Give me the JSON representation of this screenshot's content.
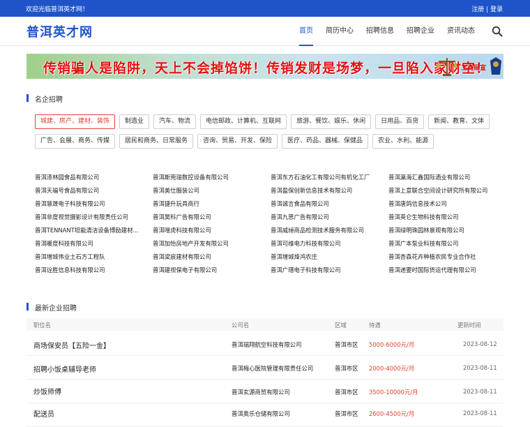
{
  "topbar": {
    "welcome": "欢迎光临普洱英才网！",
    "register": "注册",
    "sep": " | ",
    "login": "登录"
  },
  "header": {
    "logo": "普洱英才网"
  },
  "nav": [
    {
      "label": "首页",
      "active": true
    },
    {
      "label": "简历中心"
    },
    {
      "label": "招聘信息"
    },
    {
      "label": "招聘企业"
    },
    {
      "label": "资讯动态"
    }
  ],
  "banner": {
    "text": "传销骗人是陷阱，天上不会掉馅饼！传销发财是场梦，一旦陷入家财空！",
    "badge": "工商局宣"
  },
  "famous": {
    "title": "名企招聘",
    "tag_rows": [
      [
        "城建、房产、建材、装饰",
        "制造业",
        "汽车、物流",
        "电信邮政、计算机、互联网",
        "旅游、餐饮、娱乐、休闲",
        "日用品、百货",
        "新闻、教育、文体"
      ],
      [
        "广告、会展、商务、传媒",
        "居民和商务、日常服务",
        "咨询、贸易、开发、保险",
        "医疗、药品、器械、保健品",
        "农业、水利、能源"
      ]
    ],
    "companies": [
      "普洱泽林园食品有限公司",
      "普洱斯莞瑞数控设备有限公司",
      "普洱东方石油化工有限公司有机化工厂",
      "普洱瀛海汇鑫国际酒业有限公司",
      "普洱天福号食品有限公司",
      "普洱美仕服装公司",
      "普洱盈保创新信息技术有限公司",
      "普洱上意联合空间设计研究所有限公司",
      "普洱慧晟电子科技有限公司",
      "普洱捷升玩具商行",
      "普洱诚言食品有限公司",
      "普洱唐鸽信息技术公司",
      "普洱非度视觉摄影设计有限责任公司",
      "普洱昊科广告有限公司",
      "普洱九思广告有限公司",
      "普洱英仑生物科技有限公司",
      "普洱TENNANT坦能清洁设备博励建材…",
      "普洱嗖虎科技有限公司",
      "普洱威绰商品检测技术服务有限公司",
      "普洱绿明珠园林景观有限公司",
      "普洱暖度科技有限公司",
      "普洱加怡房地产开发有限公司",
      "普洱可维电力科技有限公司",
      "普洱广本泵业科技有限公司",
      "普洱增城伟业土石方工程队",
      "普洱梁宸建材有限公司",
      "普洱增城烽鸿农庄",
      "普洱杏森花卉种植农民专业合作社",
      "普洱诠胜信息科技有限公司",
      "普洱建视保电子有限公司",
      "普洱广瑨电子科技有限公司",
      "普洱递要时国际货运代理有限公司"
    ]
  },
  "latest": {
    "title": "最新企业招聘",
    "columns": {
      "position": "职位名",
      "company": "公司名",
      "area": "区域",
      "pay": "待遇",
      "updated": "更新时间"
    },
    "rows": [
      {
        "title": "商场保安员【五险一金】",
        "company": "普洱瑞翔航空科技有限公司",
        "area": "普洱市区",
        "pay": "5000-6000元/月",
        "date": "2023-08-12"
      },
      {
        "title": "招聘小饭桌辅导老师",
        "company": "普洱梅心医院管理有限责任公司",
        "area": "普洱市区",
        "pay": "2000-4000元/月",
        "date": "2023-08-11"
      },
      {
        "title": "炒饭师傅",
        "company": "普洱玄源商贸有限公司",
        "area": "普洱市区",
        "pay": "3500-10000元/月",
        "date": "2023-08-11"
      },
      {
        "title": "配送员",
        "company": "普洱奥乐仓储有限公司",
        "area": "普洱市区",
        "pay": "2600-4500元/月",
        "date": "2023-08-11"
      }
    ]
  },
  "colors": {
    "brand": "#1f54c9",
    "accent": "#e3402d"
  },
  "icons": {
    "search": "search-icon"
  }
}
